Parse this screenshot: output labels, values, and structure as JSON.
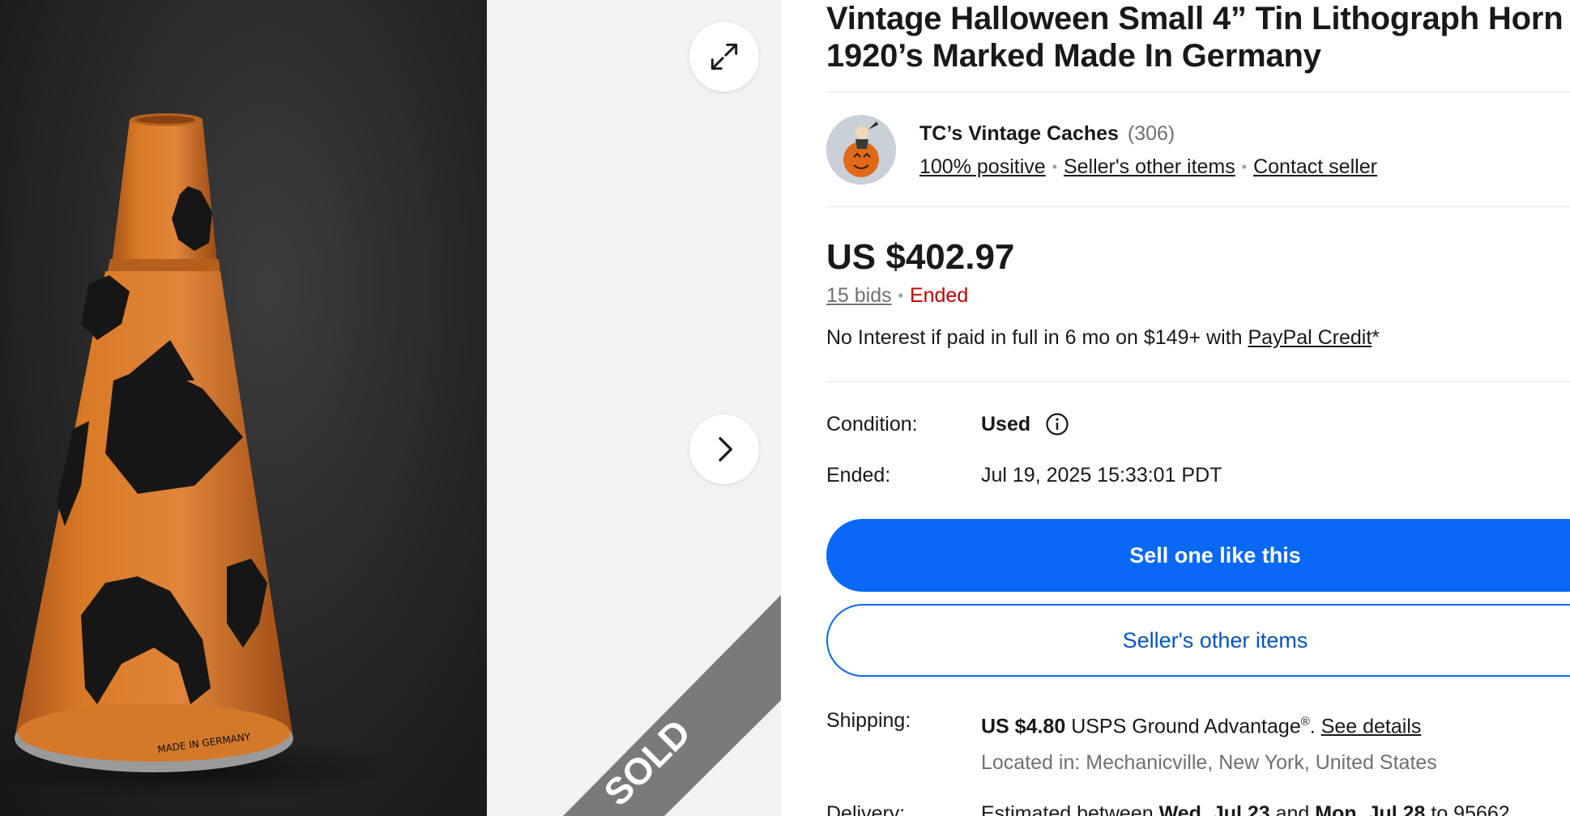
{
  "gallery": {
    "photo_imprint": "MADE IN GERMANY",
    "sold_label": "SOLD"
  },
  "listing": {
    "title": "Vintage Halloween Small 4” Tin Lithograph Horn 1920’s Marked Made In Germany"
  },
  "seller": {
    "name": "TC’s Vintage Caches",
    "feedback_count": "(306)",
    "positive": "100% positive",
    "other_items_link": "Seller's other items",
    "contact_link": "Contact seller"
  },
  "pricing": {
    "price": "US $402.97",
    "bids": "15 bids",
    "status": "Ended",
    "credit_prefix": "No Interest if paid in full in 6 mo on $149+ with ",
    "credit_link": "PayPal Credit",
    "credit_suffix": "*"
  },
  "specs": {
    "condition_label": "Condition:",
    "condition_value": "Used",
    "ended_label": "Ended:",
    "ended_value": "Jul 19, 2025 15:33:01 PDT"
  },
  "actions": {
    "sell_label": "Sell one like this",
    "other_items_label": "Seller's other items"
  },
  "shipping": {
    "label": "Shipping:",
    "price": "US $4.80",
    "service": " USPS Ground Advantage",
    "registered": "®",
    "period": ". ",
    "details_link": "See details",
    "location": "Located in: Mechanicville, New York, United States"
  },
  "delivery": {
    "label": "Delivery:",
    "prefix": "Estimated between ",
    "start": "Wed, Jul 23",
    "middle": " and ",
    "end": "Mon, Jul 28",
    "suffix": " to 95662"
  },
  "colors": {
    "primary_blue": "#0968f6",
    "link_blue": "#0654ba",
    "ended_red": "#c00000",
    "horn_orange": "#d87420"
  },
  "icons": [
    "expand-icon",
    "chevron-right-icon",
    "info-icon"
  ]
}
